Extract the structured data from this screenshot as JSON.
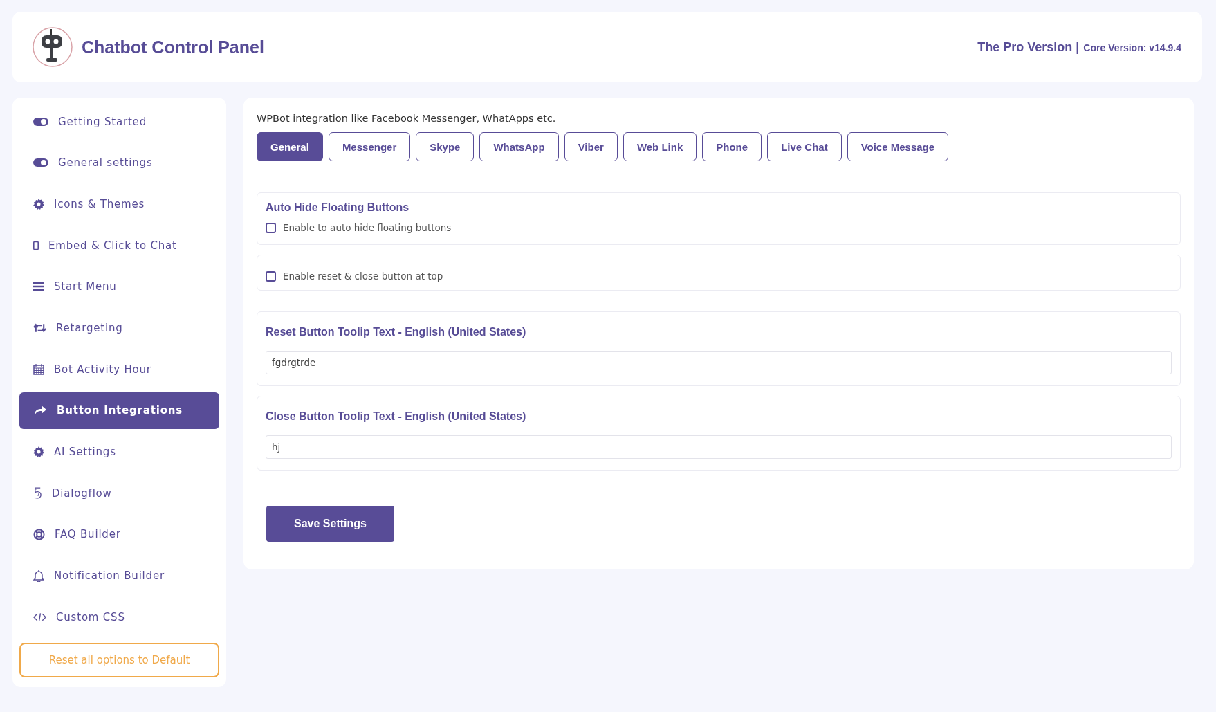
{
  "header": {
    "title": "Chatbot Control Panel",
    "version": "The Pro Version |",
    "core_version": "Core Version: v14.9.4"
  },
  "sidebar": {
    "items": [
      {
        "label": "Getting Started",
        "selected": false
      },
      {
        "label": "General settings",
        "selected": false
      },
      {
        "label": "Icons & Themes",
        "selected": false
      },
      {
        "label": "Embed & Click to Chat",
        "selected": false
      },
      {
        "label": "Start Menu",
        "selected": false
      },
      {
        "label": "Retargeting",
        "selected": false
      },
      {
        "label": "Bot Activity Hour",
        "selected": false
      },
      {
        "label": "Button Integrations",
        "selected": true
      },
      {
        "label": "AI Settings",
        "selected": false
      },
      {
        "label": "Dialogflow",
        "selected": false
      },
      {
        "label": "FAQ Builder",
        "selected": false
      },
      {
        "label": "Notification Builder",
        "selected": false
      },
      {
        "label": "Custom CSS",
        "selected": false
      }
    ],
    "reset_button": "Reset all options to Default"
  },
  "main": {
    "intro": "WPBot integration like Facebook Messenger, WhatApps etc.",
    "tabs": [
      {
        "label": "General",
        "selected": true
      },
      {
        "label": "Messenger",
        "selected": false
      },
      {
        "label": "Skype",
        "selected": false
      },
      {
        "label": "WhatsApp",
        "selected": false
      },
      {
        "label": "Viber",
        "selected": false
      },
      {
        "label": "Web Link",
        "selected": false
      },
      {
        "label": "Phone",
        "selected": false
      },
      {
        "label": "Live Chat",
        "selected": false
      },
      {
        "label": "Voice Message",
        "selected": false
      }
    ],
    "sections": [
      {
        "kind": "checkbox",
        "title": "Auto Hide Floating Buttons",
        "label": "Enable to auto hide floating buttons",
        "checked": false
      },
      {
        "kind": "checkbox",
        "label": "Enable reset & close button at top",
        "checked": false
      },
      {
        "kind": "text",
        "title": "Reset Button Toolip Text - English (United States)",
        "value": "fgdrgtrde"
      },
      {
        "kind": "text",
        "title": "Close Button Toolip Text - English (United States)",
        "value": "hj"
      }
    ],
    "save_button": "Save Settings"
  }
}
